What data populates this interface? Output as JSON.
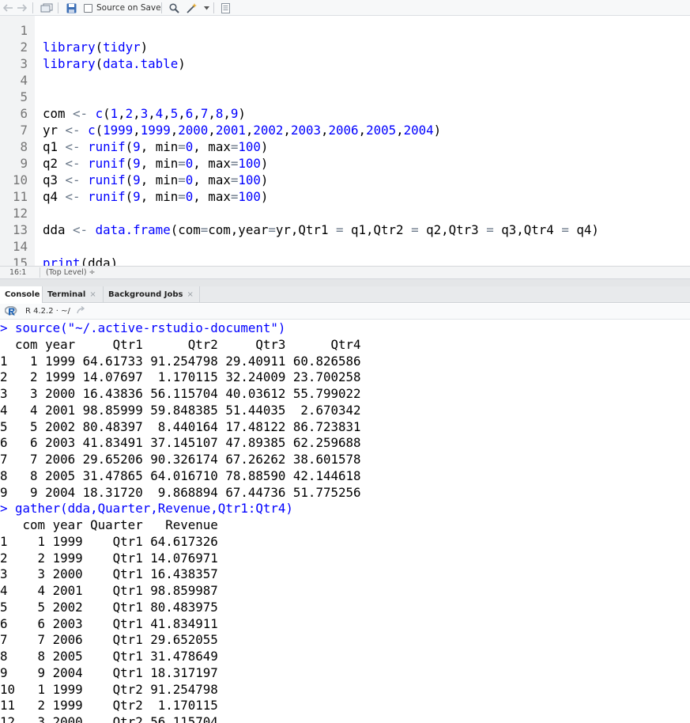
{
  "toolbar": {
    "source_on_save_label": "Source on Save"
  },
  "editor": {
    "lines": [
      {
        "n": "1",
        "code": ""
      },
      {
        "n": "2",
        "code": "library(tidyr)"
      },
      {
        "n": "3",
        "code": "library(data.table)"
      },
      {
        "n": "4",
        "code": ""
      },
      {
        "n": "5",
        "code": ""
      },
      {
        "n": "6",
        "code": "com <- c(1,2,3,4,5,6,7,8,9)"
      },
      {
        "n": "7",
        "code": "yr <- c(1999,1999,2000,2001,2002,2003,2006,2005,2004)"
      },
      {
        "n": "8",
        "code": "q1 <- runif(9, min=0, max=100)"
      },
      {
        "n": "9",
        "code": "q2 <- runif(9, min=0, max=100)"
      },
      {
        "n": "10",
        "code": "q3 <- runif(9, min=0, max=100)"
      },
      {
        "n": "11",
        "code": "q4 <- runif(9, min=0, max=100)"
      },
      {
        "n": "12",
        "code": ""
      },
      {
        "n": "13",
        "code": "dda <- data.frame(com=com,year=yr,Qtr1 = q1,Qtr2 = q2,Qtr3 = q3,Qtr4 = q4)"
      },
      {
        "n": "14",
        "code": ""
      },
      {
        "n": "15",
        "code": "print(dda)"
      }
    ]
  },
  "status": {
    "cursor_position": "16:1",
    "scope": "(Top Level) ÷"
  },
  "tabs": [
    {
      "label": "Console",
      "closable": false
    },
    {
      "label": "Terminal",
      "closable": true
    },
    {
      "label": "Background Jobs",
      "closable": true
    }
  ],
  "console": {
    "r_version": "R 4.2.2 · ~/",
    "lines": [
      {
        "type": "cmd",
        "text": "> source(\"~/.active-rstudio-document\")"
      },
      {
        "type": "out",
        "text": "  com year     Qtr1      Qtr2     Qtr3      Qtr4"
      },
      {
        "type": "out",
        "text": "1   1 1999 64.61733 91.254798 29.40911 60.826586"
      },
      {
        "type": "out",
        "text": "2   2 1999 14.07697  1.170115 32.24009 23.700258"
      },
      {
        "type": "out",
        "text": "3   3 2000 16.43836 56.115704 40.03612 55.799022"
      },
      {
        "type": "out",
        "text": "4   4 2001 98.85999 59.848385 51.44035  2.670342"
      },
      {
        "type": "out",
        "text": "5   5 2002 80.48397  8.440164 17.48122 86.723831"
      },
      {
        "type": "out",
        "text": "6   6 2003 41.83491 37.145107 47.89385 62.259688"
      },
      {
        "type": "out",
        "text": "7   7 2006 29.65206 90.326174 67.26262 38.601578"
      },
      {
        "type": "out",
        "text": "8   8 2005 31.47865 64.016710 78.88590 42.144618"
      },
      {
        "type": "out",
        "text": "9   9 2004 18.31720  9.868894 67.44736 51.775256"
      },
      {
        "type": "cmd",
        "text": "> gather(dda,Quarter,Revenue,Qtr1:Qtr4)"
      },
      {
        "type": "out",
        "text": "   com year Quarter   Revenue"
      },
      {
        "type": "out",
        "text": "1    1 1999    Qtr1 64.617326"
      },
      {
        "type": "out",
        "text": "2    2 1999    Qtr1 14.076971"
      },
      {
        "type": "out",
        "text": "3    3 2000    Qtr1 16.438357"
      },
      {
        "type": "out",
        "text": "4    4 2001    Qtr1 98.859987"
      },
      {
        "type": "out",
        "text": "5    5 2002    Qtr1 80.483975"
      },
      {
        "type": "out",
        "text": "6    6 2003    Qtr1 41.834911"
      },
      {
        "type": "out",
        "text": "7    7 2006    Qtr1 29.652055"
      },
      {
        "type": "out",
        "text": "8    8 2005    Qtr1 31.478649"
      },
      {
        "type": "out",
        "text": "9    9 2004    Qtr1 18.317197"
      },
      {
        "type": "out",
        "text": "10   1 1999    Qtr2 91.254798"
      },
      {
        "type": "out",
        "text": "11   2 1999    Qtr2  1.170115"
      },
      {
        "type": "out",
        "text": "12   3 2000    Qtr2 56.115704"
      }
    ]
  },
  "colors": {
    "keyword": "#0000ff",
    "command": "#0000ff",
    "gutter_bg": "#f2f3f4",
    "line_number": "#767676"
  },
  "icons": [
    "back-arrow-icon",
    "forward-arrow-icon",
    "show-in-window-icon",
    "save-icon",
    "search-icon",
    "magic-wand-icon",
    "dropdown-caret-icon",
    "document-outline-icon",
    "r-logo-icon",
    "goto-dir-arrow-icon"
  ]
}
